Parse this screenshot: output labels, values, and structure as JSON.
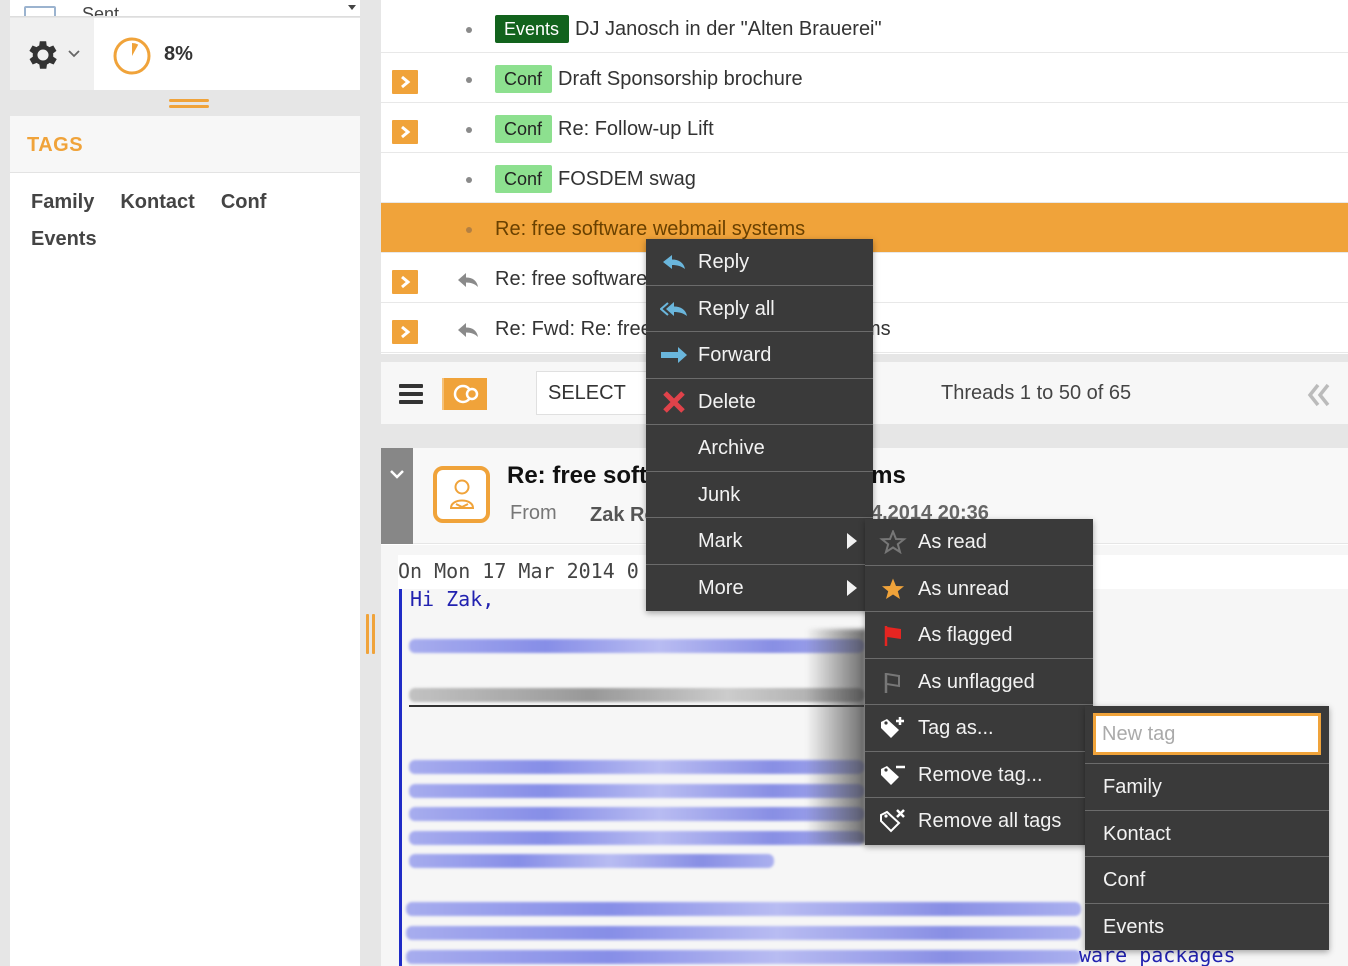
{
  "sidebar": {
    "folder_name": "Sent",
    "quota": {
      "percent_label": "8%",
      "used_fraction": 0.08
    },
    "tags_header": "TAGS",
    "tags": [
      "Family",
      "Kontact",
      "Conf",
      "Events"
    ]
  },
  "messages": [
    {
      "tag": "Events",
      "tag_style": "events",
      "subject": "DJ Janosch in der \"Alten Brauerei\"",
      "expandable": false,
      "replied": false,
      "selected": false
    },
    {
      "tag": "Conf",
      "tag_style": "conf",
      "subject": "Draft Sponsorship brochure",
      "expandable": true,
      "replied": false,
      "selected": false
    },
    {
      "tag": "Conf",
      "tag_style": "conf",
      "subject": "Re: Follow-up Lift",
      "expandable": true,
      "replied": false,
      "selected": false
    },
    {
      "tag": "Conf",
      "tag_style": "conf",
      "subject": "FOSDEM swag",
      "expandable": false,
      "replied": false,
      "selected": false
    },
    {
      "tag": "",
      "tag_style": "",
      "subject": "Re: free software webmail systems",
      "expandable": false,
      "replied": false,
      "selected": true
    },
    {
      "tag": "",
      "tag_style": "",
      "subject": "Re: free software webmail systems",
      "expandable": true,
      "replied": true,
      "selected": false
    },
    {
      "tag": "",
      "tag_style": "",
      "subject": "Re: Fwd: Re: free software webmail systems",
      "expandable": true,
      "replied": true,
      "selected": false
    }
  ],
  "toolbar": {
    "select_label": "SELECT",
    "count_text": "Threads 1 to 50 of 65"
  },
  "preview": {
    "subject": "Re: free software webmail systems",
    "from_label": "From",
    "from_name": "Zak Rogoff",
    "date": "4.2014 20:36",
    "intro_line": "On Mon 17 Mar 2014 0",
    "greeting": "Hi Zak,",
    "tail_text": "ware packages"
  },
  "context_menu": {
    "items": [
      {
        "label": "Reply",
        "icon": "reply-icon"
      },
      {
        "label": "Reply all",
        "icon": "reply-all-icon"
      },
      {
        "label": "Forward",
        "icon": "forward-icon"
      },
      {
        "label": "Delete",
        "icon": "delete-icon"
      },
      {
        "label": "Archive",
        "icon": ""
      },
      {
        "label": "Junk",
        "icon": ""
      },
      {
        "label": "Mark",
        "icon": "",
        "submenu": true
      },
      {
        "label": "More",
        "icon": "",
        "submenu": true
      }
    ]
  },
  "mark_menu": {
    "items": [
      {
        "label": "As read",
        "icon": "star-outline-icon"
      },
      {
        "label": "As unread",
        "icon": "star-filled-icon"
      },
      {
        "label": "As flagged",
        "icon": "flag-red-icon"
      },
      {
        "label": "As unflagged",
        "icon": "flag-outline-icon"
      },
      {
        "label": "Tag as...",
        "icon": "tag-add-icon"
      },
      {
        "label": "Remove tag...",
        "icon": "tag-remove-icon"
      },
      {
        "label": "Remove all tags",
        "icon": "tag-remove-all-icon"
      }
    ]
  },
  "tag_menu": {
    "input_placeholder": "New tag",
    "input_value": "",
    "items": [
      "Family",
      "Kontact",
      "Conf",
      "Events"
    ]
  },
  "colors": {
    "accent": "#f0a33a",
    "events_badge": "#12631d",
    "conf_badge": "#8de08f",
    "menu_bg": "#3a3a3a",
    "flag_red": "#e52521",
    "reply_blue": "#6ab6dc"
  }
}
